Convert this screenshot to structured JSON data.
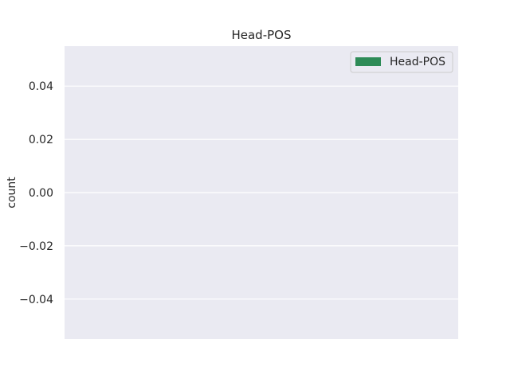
{
  "chart_data": {
    "type": "bar",
    "title": "Head-POS",
    "xlabel": "",
    "ylabel": "count",
    "categories": [],
    "series": [
      {
        "name": "Head-POS",
        "values": []
      }
    ],
    "ylim": [
      -0.055,
      0.055
    ],
    "yticks": [
      0.04,
      0.02,
      0.0,
      -0.02,
      -0.04
    ],
    "ytick_labels": [
      "0.04",
      "0.02",
      "0.00",
      "−0.02",
      "−0.04"
    ],
    "grid": true,
    "legend_position": "top-right",
    "colors": {
      "plot_background": "#eaeaf2",
      "grid": "#ffffff",
      "series": "#2e8b57",
      "text": "#262626"
    }
  }
}
